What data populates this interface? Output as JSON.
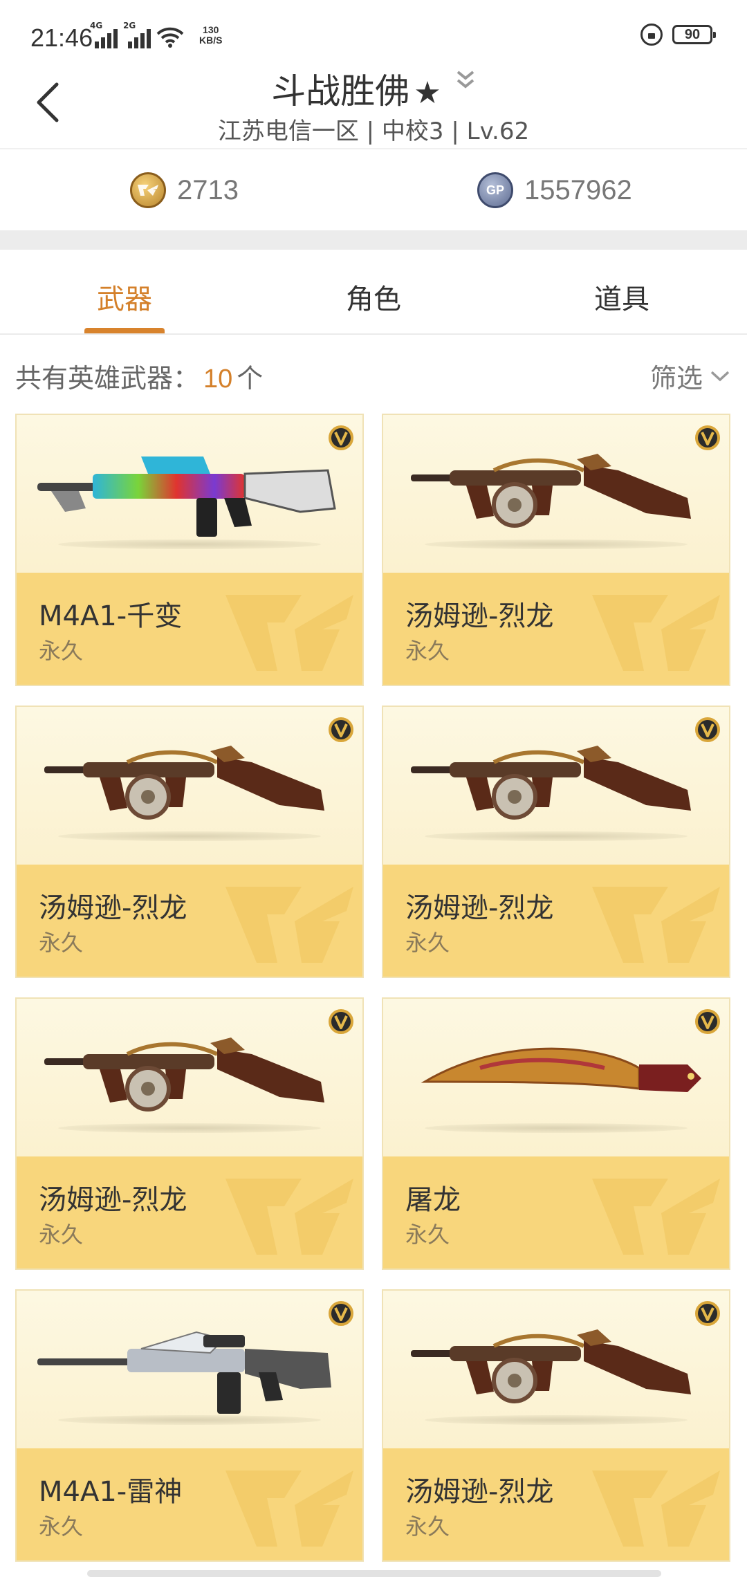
{
  "status": {
    "time": "21:46",
    "net1": "4G",
    "net2": "2G",
    "speed_value": "130",
    "speed_unit": "KB/S",
    "battery": "90"
  },
  "header": {
    "title": "斗战胜佛",
    "star": "★",
    "subtitle": "江苏电信一区 | 中校3 | Lv.62"
  },
  "currency": {
    "cf_amount": "2713",
    "gp_amount": "1557962",
    "cf_icon": "cf-coin-icon",
    "gp_icon": "gp-coin-icon",
    "gp_label": "GP"
  },
  "tabs": [
    {
      "label": "武器",
      "active": true
    },
    {
      "label": "角色",
      "active": false
    },
    {
      "label": "道具",
      "active": false
    }
  ],
  "summary": {
    "prefix": "共有英雄武器：",
    "count": "10",
    "suffix": "个",
    "filter_label": "筛选"
  },
  "items": [
    {
      "name": "M4A1-千变",
      "duration": "永久",
      "kind": "rifle-rainbow"
    },
    {
      "name": "汤姆逊-烈龙",
      "duration": "永久",
      "kind": "tommy"
    },
    {
      "name": "汤姆逊-烈龙",
      "duration": "永久",
      "kind": "tommy"
    },
    {
      "name": "汤姆逊-烈龙",
      "duration": "永久",
      "kind": "tommy"
    },
    {
      "name": "汤姆逊-烈龙",
      "duration": "永久",
      "kind": "tommy"
    },
    {
      "name": "屠龙",
      "duration": "永久",
      "kind": "knife"
    },
    {
      "name": "M4A1-雷神",
      "duration": "永久",
      "kind": "rifle-silver"
    },
    {
      "name": "汤姆逊-烈龙",
      "duration": "永久",
      "kind": "tommy"
    }
  ],
  "colors": {
    "accent": "#d4802a",
    "card_bottom": "#f8d67c",
    "card_top": "#fdf6d8"
  }
}
